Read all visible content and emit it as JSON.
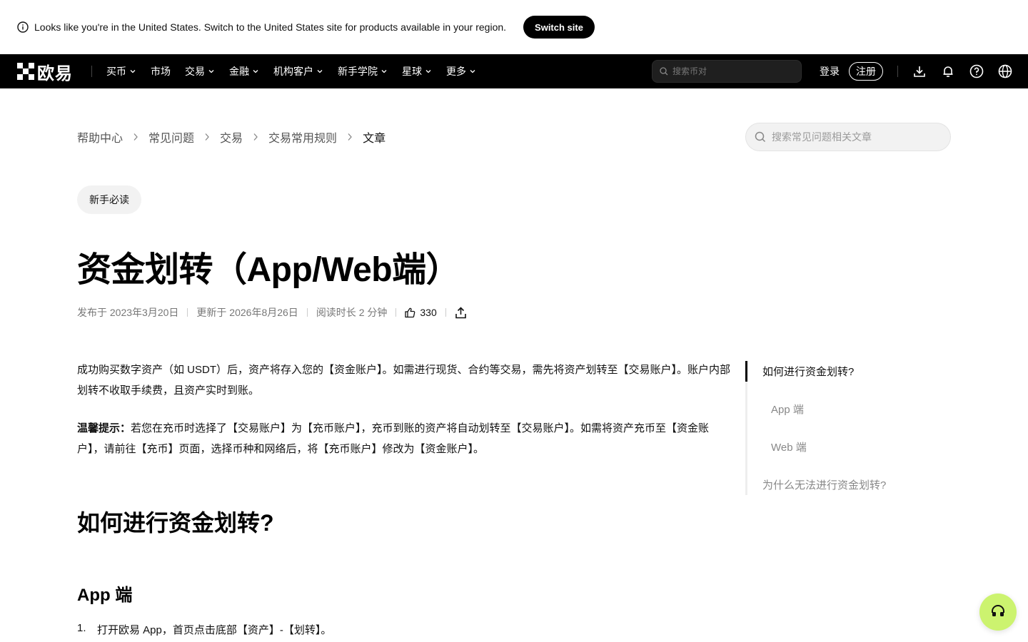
{
  "banner": {
    "message": "Looks like you're in the United States. Switch to the United States site for products available in your region.",
    "switch_label": "Switch site"
  },
  "nav": {
    "logo_text": "欧易",
    "items": [
      {
        "label": "买币",
        "has_dropdown": true
      },
      {
        "label": "市场",
        "has_dropdown": false
      },
      {
        "label": "交易",
        "has_dropdown": true
      },
      {
        "label": "金融",
        "has_dropdown": true
      },
      {
        "label": "机构客户",
        "has_dropdown": true
      },
      {
        "label": "新手学院",
        "has_dropdown": true
      },
      {
        "label": "星球",
        "has_dropdown": true
      },
      {
        "label": "更多",
        "has_dropdown": true
      }
    ],
    "search_placeholder": "搜索币对",
    "login_label": "登录",
    "register_label": "注册",
    "icons": [
      "download-icon",
      "bell-icon",
      "help-icon",
      "globe-icon"
    ]
  },
  "breadcrumb": {
    "items": [
      "帮助中心",
      "常见问题",
      "交易",
      "交易常用规则",
      "文章"
    ]
  },
  "help_search": {
    "placeholder": "搜索常见问题相关文章"
  },
  "article": {
    "tag": "新手必读",
    "title": "资金划转（App/Web端）",
    "published": "发布于 2023年3月20日",
    "updated": "更新于 2026年8月26日",
    "read_time": "阅读时长 2 分钟",
    "likes": "330",
    "intro": "成功购买数字资产（如 USDT）后，资产将存入您的【资金账户】。如需进行现货、合约等交易，需先将资产划转至【交易账户】。账户内部划转不收取手续费，且资产实时到账。",
    "tip_label": "温馨提示：",
    "tip_text": "若您在充币时选择了【交易账户】为【充币账户】，充币到账的资产将自动划转至【交易账户】。如需将资产充币至【资金账户】，请前往【充币】页面，选择币种和网络后，将【充币账户】修改为【资金账户】。",
    "h2": "如何进行资金划转?",
    "h3": "App 端",
    "step_num": "1.",
    "step_text": "打开欧易 App，首页点击底部【资产】-【划转】。"
  },
  "toc": {
    "items": [
      {
        "label": "如何进行资金划转?",
        "active": true
      },
      {
        "label": "App 端",
        "active": false
      },
      {
        "label": "Web 端",
        "active": false
      },
      {
        "label": "为什么无法进行资金划转?",
        "active": false
      }
    ]
  },
  "colors": {
    "nav_bg": "#000000",
    "support_bg": "#ccf36f",
    "tag_bg": "#f2f2f2"
  }
}
